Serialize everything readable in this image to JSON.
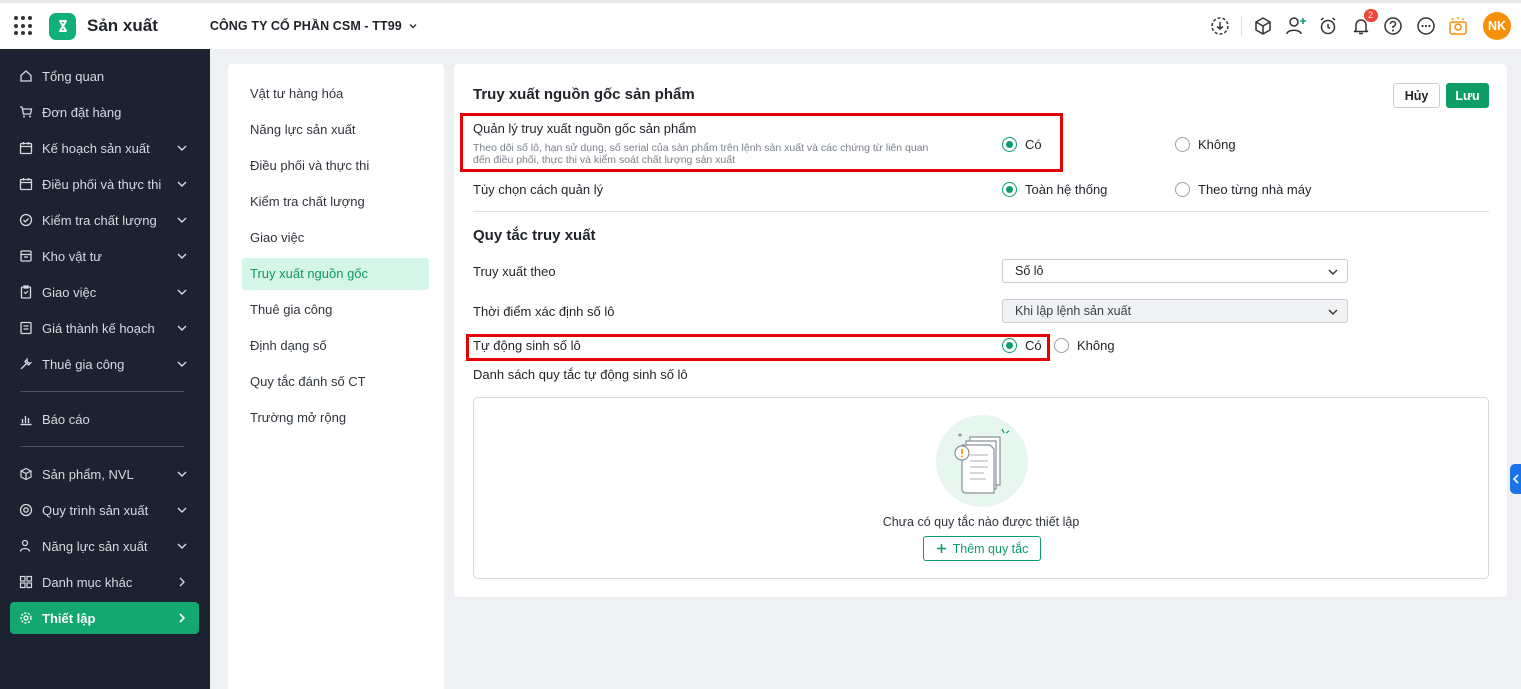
{
  "app": {
    "title": "Sản xuất",
    "company": "CÔNG TY CỔ PHẦN CSM - TT99"
  },
  "topbar": {
    "icons": [
      "download-icon",
      "box-icon",
      "add-user-icon",
      "alarm-icon",
      "bell-icon",
      "help-icon",
      "more-icon",
      "lightbulb-icon"
    ],
    "notification_count": "2",
    "avatar_initials": "NK"
  },
  "sidebar": {
    "items": [
      {
        "label": "Tổng quan",
        "icon": "home-icon"
      },
      {
        "label": "Đơn đặt hàng",
        "icon": "cart-icon"
      },
      {
        "label": "Kế hoạch sản xuất",
        "icon": "calendar-icon"
      },
      {
        "label": "Điều phối và thực thi",
        "icon": "calendar-icon"
      },
      {
        "label": "Kiểm tra chất lượng",
        "icon": "quality-icon"
      },
      {
        "label": "Kho vật tư",
        "icon": "warehouse-icon"
      },
      {
        "label": "Giao việc",
        "icon": "clipboard-icon"
      },
      {
        "label": "Giá thành kế hoạch",
        "icon": "price-icon"
      },
      {
        "label": "Thuê gia công",
        "icon": "tool-icon"
      },
      {
        "label": "Báo cáo",
        "icon": "chart-icon"
      },
      {
        "label": "Sản phẩm, NVL",
        "icon": "cube-icon"
      },
      {
        "label": "Quy trình sản xuất",
        "icon": "process-icon"
      },
      {
        "label": "Năng lực sản xuất",
        "icon": "person-icon"
      },
      {
        "label": "Danh mục khác",
        "icon": "grid-icon"
      },
      {
        "label": "Thiết lập",
        "icon": "gear-icon"
      }
    ]
  },
  "submenu": {
    "items": [
      "Vật tư hàng hóa",
      "Năng lực sản xuất",
      "Điều phối và thực thi",
      "Kiểm tra chất lượng",
      "Giao việc",
      "Truy xuất nguồn gốc",
      "Thuê gia công",
      "Định dạng số",
      "Quy tắc đánh số CT",
      "Trường mở rộng"
    ],
    "active": "Truy xuất nguồn gốc"
  },
  "main": {
    "title": "Truy xuất nguồn gốc sản phẩm",
    "cancel_label": "Hủy",
    "save_label": "Lưu",
    "manage_trace": {
      "label": "Quản lý truy xuất nguồn gốc sản phẩm",
      "description": "Theo dõi số lô, hạn sử dụng, số serial của sản phẩm trên lệnh sản xuất và các chứng từ liên quan đến điều phối, thực thi và kiểm soát chất lượng sản xuất",
      "yes": "Có",
      "no": "Không",
      "selected": "yes"
    },
    "manage_option": {
      "label": "Tùy chọn cách quản lý",
      "opt1": "Toàn hệ thống",
      "opt2": "Theo từng nhà máy",
      "selected": "opt1"
    },
    "rules": {
      "title": "Quy tắc truy xuất",
      "trace_by_label": "Truy xuất theo",
      "trace_by_value": "Số lô",
      "lot_time_label": "Thời điểm xác định số lô",
      "lot_time_value": "Khi lập lệnh sản xuất",
      "auto_lot_label": "Tự động sinh số lô",
      "auto_yes": "Có",
      "auto_no": "Không",
      "auto_selected": "yes",
      "list_label": "Danh sách quy tắc tự động sinh số lô",
      "empty_text": "Chưa có quy tắc nào được thiết lập",
      "add_label": "Thêm quy tắc"
    }
  },
  "colors": {
    "accent": "#0f9d66",
    "sidebar_bg": "#1d2230",
    "highlight": "#e60000"
  }
}
